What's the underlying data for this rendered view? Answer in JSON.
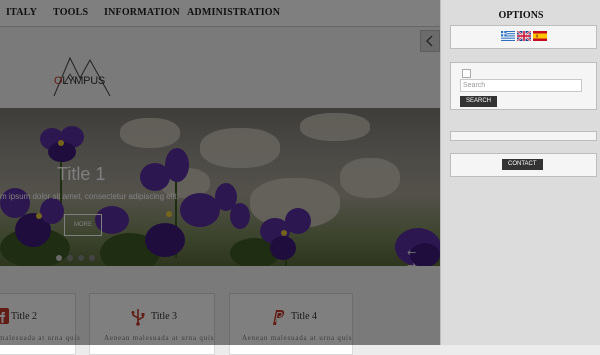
{
  "nav": {
    "items": [
      {
        "label": "ITALY"
      },
      {
        "label": "TOOLS"
      },
      {
        "label": "INFORMATION"
      },
      {
        "label": "ADMINISTRATION"
      }
    ]
  },
  "logo": {
    "text": "OLYMPUS"
  },
  "slider": {
    "title": "Title 1",
    "text": "m ipsum dolor sit amet, consectetur adipiscing elit.",
    "more_label": "MORE",
    "arrows": "← →"
  },
  "features": [
    {
      "title": "Title 2",
      "text": "malesuada at urna quis",
      "icon": "facebook-icon"
    },
    {
      "title": "Title 3",
      "text": "Aenean malesuada at urna quis",
      "icon": "usb-icon"
    },
    {
      "title": "Title 4",
      "text": "Aenean malesuada at urna quis",
      "icon": "paypal-icon"
    }
  ],
  "options_panel": {
    "title": "OPTIONS",
    "languages": [
      "Greek",
      "English",
      "Spanish"
    ],
    "search": {
      "placeholder": "Search",
      "button_label": "SEARCH"
    },
    "contact_label": "CONTACT"
  },
  "colors": {
    "overlay": "#000000",
    "panel_bg": "#dcdcdc",
    "button_dark": "#333333",
    "flower": "#5a2fa0"
  }
}
